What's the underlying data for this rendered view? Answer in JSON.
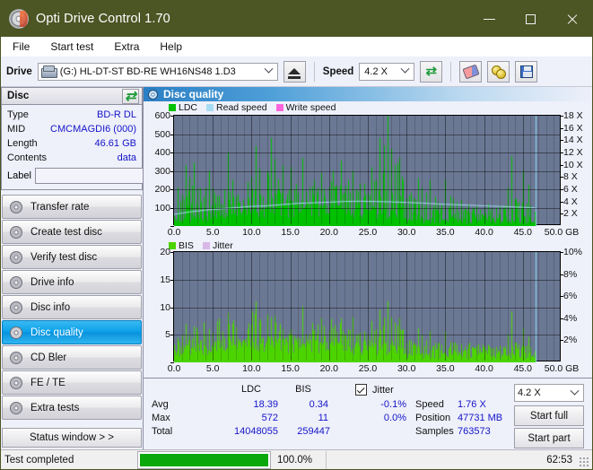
{
  "window": {
    "title": "Opti Drive Control 1.70",
    "icon": "disc-icon",
    "minimize": "minimize",
    "maximize": "maximize",
    "close": "close"
  },
  "menu": [
    "File",
    "Start test",
    "Extra",
    "Help"
  ],
  "toolbar": {
    "drive_label": "Drive",
    "drive_value": "(G:)  HL-DT-ST BD-RE  WH16NS48 1.D3",
    "eject_icon": "eject-icon",
    "speed_label": "Speed",
    "speed_value": "4.2 X",
    "refresh_icon": "refresh-icon",
    "erase_icon": "erase-icon",
    "gold_icon": "bookmark-icon",
    "save_icon": "save-icon"
  },
  "disc": {
    "title": "Disc",
    "refresh_icon": "refresh-icon",
    "rows": [
      {
        "key": "Type",
        "value": "BD-R DL"
      },
      {
        "key": "MID",
        "value": "CMCMAGDI6 (000)"
      },
      {
        "key": "Length",
        "value": "46.61 GB"
      },
      {
        "key": "Contents",
        "value": "data"
      }
    ],
    "label_key": "Label",
    "label_value": "",
    "label_placeholder": "",
    "label_button_icon": "cd-icon"
  },
  "nav": {
    "items": [
      {
        "label": "Transfer rate",
        "active": false
      },
      {
        "label": "Create test disc",
        "active": false
      },
      {
        "label": "Verify test disc",
        "active": false
      },
      {
        "label": "Drive info",
        "active": false
      },
      {
        "label": "Disc info",
        "active": false
      },
      {
        "label": "Disc quality",
        "active": true
      },
      {
        "label": "CD Bler",
        "active": false
      },
      {
        "label": "FE / TE",
        "active": false
      },
      {
        "label": "Extra tests",
        "active": false
      }
    ],
    "status_window": "Status window > >"
  },
  "panel": {
    "title": "Disc quality",
    "icon": "disc-quality-icon"
  },
  "stats": {
    "col_ldc": "LDC",
    "col_bis": "BIS",
    "jitter_label": "Jitter",
    "jitter_checked": true,
    "rows": [
      {
        "label": "Avg",
        "ldc": "18.39",
        "bis": "0.34",
        "jitter": "-0.1%"
      },
      {
        "label": "Max",
        "ldc": "572",
        "bis": "11",
        "jitter": "0.0%"
      },
      {
        "label": "Total",
        "ldc": "14048055",
        "bis": "259447",
        "jitter": ""
      }
    ],
    "speed_label": "Speed",
    "speed_value": "1.76 X",
    "position_label": "Position",
    "position_value": "47731 MB",
    "samples_label": "Samples",
    "samples_value": "763573",
    "speed_select": "4.2 X",
    "start_full": "Start full",
    "start_part": "Start part"
  },
  "statusbar": {
    "text": "Test completed",
    "percent": "100.0%",
    "progress": 100,
    "time": "62:53"
  },
  "colors": {
    "titlebar": "#4c5524",
    "ldc_green": "#00c000",
    "bis_green": "#4cd400",
    "read_speed": "#a8dcf4",
    "write_speed": "#ff66dd",
    "jitter": "#d9b8e8",
    "plot_bg": "#6b7894",
    "value_blue": "#1414c8",
    "accent": "#0aa0e8",
    "progress": "#0aa80a"
  },
  "chart_data": [
    {
      "id": "top",
      "type": "area",
      "title": "",
      "xlabel": "GB",
      "ylabel": "",
      "xlim": [
        0,
        50
      ],
      "ylim": [
        0,
        600
      ],
      "y2lim": [
        0,
        18
      ],
      "y2label": "X",
      "xticks": [
        "0.0",
        "5.0",
        "10.0",
        "15.0",
        "20.0",
        "25.0",
        "30.0",
        "35.0",
        "40.0",
        "45.0",
        "50.0"
      ],
      "xtick_suffix": "GB",
      "yticks": [
        0,
        100,
        200,
        300,
        400,
        500,
        600
      ],
      "y2ticks": [
        2,
        4,
        6,
        8,
        10,
        12,
        14,
        16,
        18
      ],
      "grid": true,
      "legend": [
        {
          "name": "LDC",
          "color": "#00c000"
        },
        {
          "name": "Read speed",
          "color": "#a8dcf4"
        },
        {
          "name": "Write speed",
          "color": "#ff66dd"
        }
      ],
      "data_end_gb": 46.61,
      "series": [
        {
          "name": "LDC",
          "color": "#00c000",
          "type": "spike-area",
          "x": [
            0.0,
            0.5,
            1.0,
            1.5,
            2.0,
            2.5,
            3.0,
            3.5,
            4.0,
            4.5,
            5.0,
            5.5,
            6.0,
            6.5,
            7.0,
            7.5,
            8.0,
            8.5,
            9.0,
            9.5,
            10.0,
            10.5,
            11.0,
            11.5,
            12.0,
            12.5,
            13.0,
            13.5,
            14.0,
            14.5,
            15.0,
            15.5,
            16.0,
            16.5,
            17.0,
            17.5,
            18.0,
            18.5,
            19.0,
            19.5,
            20.0,
            20.5,
            21.0,
            21.5,
            22.0,
            22.5,
            23.0,
            23.5,
            24.0,
            24.5,
            25.0,
            25.5,
            26.0,
            26.5,
            27.0,
            27.5,
            28.0,
            28.5,
            29.0,
            29.5,
            30.0,
            30.5,
            31.0,
            31.5,
            32.0,
            32.5,
            33.0,
            33.5,
            34.0,
            34.5,
            35.0,
            35.5,
            36.0,
            36.5,
            37.0,
            37.5,
            38.0,
            38.5,
            39.0,
            39.5,
            40.0,
            40.5,
            41.0,
            41.5,
            42.0,
            42.5,
            43.0,
            43.5,
            44.0,
            44.5,
            45.0,
            45.5,
            46.0,
            46.6
          ],
          "baseline": [
            28,
            34,
            40,
            44,
            46,
            50,
            52,
            54,
            56,
            58,
            60,
            62,
            64,
            66,
            66,
            68,
            70,
            72,
            72,
            74,
            76,
            78,
            80,
            82,
            84,
            86,
            86,
            88,
            90,
            90,
            92,
            92,
            94,
            94,
            96,
            96,
            96,
            96,
            96,
            96,
            94,
            94,
            94,
            92,
            92,
            90,
            90,
            88,
            88,
            86,
            84,
            82,
            80,
            78,
            76,
            74,
            72,
            70,
            68,
            64,
            40,
            36,
            34,
            32,
            32,
            30,
            30,
            30,
            28,
            28,
            28,
            28,
            28,
            28,
            28,
            26,
            26,
            26,
            26,
            26,
            26,
            26,
            26,
            26,
            26,
            26,
            26,
            26,
            26,
            26,
            26,
            26,
            26,
            26
          ],
          "peaks": [
            60,
            210,
            170,
            330,
            265,
            345,
            205,
            130,
            210,
            300,
            205,
            165,
            120,
            100,
            400,
            250,
            160,
            130,
            115,
            240,
            130,
            435,
            180,
            160,
            300,
            480,
            365,
            200,
            330,
            145,
            320,
            200,
            180,
            370,
            190,
            210,
            250,
            150,
            290,
            160,
            210,
            300,
            210,
            355,
            180,
            250,
            300,
            200,
            230,
            230,
            180,
            320,
            250,
            480,
            290,
            600,
            420,
            330,
            370,
            250,
            150,
            180,
            120,
            260,
            210,
            130,
            250,
            110,
            130,
            120,
            250,
            100,
            150,
            130,
            140,
            100,
            120,
            100,
            110,
            90,
            100,
            120,
            90,
            100,
            110,
            100,
            160,
            380,
            150,
            130,
            300,
            120,
            110,
            80
          ]
        },
        {
          "name": "Read speed",
          "color": "#a8dcf4",
          "type": "line",
          "axis": "right",
          "x": [
            0.0,
            2.0,
            4.0,
            6.0,
            8.0,
            10.0,
            12.0,
            14.0,
            16.0,
            18.0,
            20.0,
            22.0,
            24.0,
            26.0,
            28.0,
            30.0,
            32.0,
            34.0,
            36.0,
            38.0,
            40.0,
            42.0,
            44.0,
            46.0,
            46.6
          ],
          "values": [
            1.9,
            2.3,
            2.6,
            2.8,
            3.0,
            3.2,
            3.3,
            3.5,
            3.7,
            3.8,
            3.9,
            4.0,
            4.05,
            4.0,
            3.95,
            3.85,
            3.75,
            3.6,
            3.5,
            3.4,
            3.3,
            3.2,
            3.1,
            3.0,
            2.95
          ]
        }
      ]
    },
    {
      "id": "bottom",
      "type": "area",
      "title": "",
      "xlabel": "GB",
      "ylabel": "",
      "xlim": [
        0,
        50
      ],
      "ylim": [
        0,
        20
      ],
      "y2lim": [
        0,
        10
      ],
      "y2label": "%",
      "xticks": [
        "0.0",
        "5.0",
        "10.0",
        "15.0",
        "20.0",
        "25.0",
        "30.0",
        "35.0",
        "40.0",
        "45.0",
        "50.0"
      ],
      "xtick_suffix": "GB",
      "yticks": [
        0,
        5,
        10,
        15,
        20
      ],
      "y2ticks": [
        2,
        4,
        6,
        8,
        10
      ],
      "grid": true,
      "legend": [
        {
          "name": "BIS",
          "color": "#4cd400"
        },
        {
          "name": "Jitter",
          "color": "#d9b8e8"
        }
      ],
      "data_end_gb": 46.61,
      "series": [
        {
          "name": "BIS",
          "color": "#4cd400",
          "type": "spike-area",
          "x": [
            0.0,
            0.5,
            1.0,
            1.5,
            2.0,
            2.5,
            3.0,
            3.5,
            4.0,
            4.5,
            5.0,
            5.5,
            6.0,
            6.5,
            7.0,
            7.5,
            8.0,
            8.5,
            9.0,
            9.5,
            10.0,
            10.5,
            11.0,
            11.5,
            12.0,
            12.5,
            13.0,
            13.5,
            14.0,
            14.5,
            15.0,
            15.5,
            16.0,
            16.5,
            17.0,
            17.5,
            18.0,
            18.5,
            19.0,
            19.5,
            20.0,
            20.5,
            21.0,
            21.5,
            22.0,
            22.5,
            23.0,
            23.5,
            24.0,
            24.5,
            25.0,
            25.5,
            26.0,
            26.5,
            27.0,
            27.5,
            28.0,
            28.5,
            29.0,
            29.5,
            30.0,
            30.5,
            31.0,
            31.5,
            32.0,
            32.5,
            33.0,
            33.5,
            34.0,
            34.5,
            35.0,
            35.5,
            36.0,
            36.5,
            37.0,
            37.5,
            38.0,
            38.5,
            39.0,
            39.5,
            40.0,
            40.5,
            41.0,
            41.5,
            42.0,
            42.5,
            43.0,
            43.5,
            44.0,
            44.5,
            45.0,
            45.5,
            46.0,
            46.6
          ],
          "baseline": [
            1.6,
            1.8,
            2.2,
            2.4,
            2.6,
            2.7,
            2.7,
            2.8,
            2.8,
            2.9,
            3.0,
            3.0,
            3.1,
            3.2,
            3.2,
            3.3,
            3.3,
            3.4,
            3.4,
            3.5,
            3.5,
            3.5,
            3.5,
            3.5,
            3.5,
            3.5,
            3.5,
            3.4,
            3.4,
            3.4,
            3.4,
            3.3,
            3.3,
            3.3,
            3.3,
            3.2,
            3.2,
            3.2,
            3.1,
            3.1,
            3.1,
            3.0,
            3.0,
            3.0,
            3.0,
            2.9,
            2.9,
            2.9,
            2.9,
            2.9,
            2.9,
            2.8,
            2.8,
            2.8,
            2.8,
            2.8,
            2.7,
            2.6,
            2.5,
            2.3,
            1.6,
            1.5,
            1.5,
            1.5,
            1.5,
            1.4,
            1.4,
            1.4,
            1.4,
            1.4,
            1.4,
            1.4,
            1.4,
            1.4,
            1.4,
            1.4,
            1.4,
            1.4,
            1.4,
            1.4,
            1.4,
            1.4,
            1.4,
            1.4,
            1.4,
            1.4,
            1.4,
            1.4,
            1.4,
            1.4,
            1.4,
            1.4,
            1.4,
            1.3
          ],
          "peaks": [
            3.2,
            4.5,
            5.0,
            7.0,
            5.2,
            6.5,
            4.5,
            4.0,
            5.0,
            6.0,
            5.4,
            4.4,
            4.0,
            3.8,
            9.0,
            6.2,
            4.6,
            4.2,
            4.0,
            6.0,
            5.2,
            11.0,
            5.0,
            4.6,
            8.7,
            8.2,
            8.5,
            5.6,
            6.0,
            4.6,
            6.0,
            4.8,
            4.6,
            10.2,
            5.0,
            5.2,
            6.0,
            4.6,
            8.0,
            4.8,
            5.6,
            6.2,
            5.5,
            8.0,
            5.2,
            6.0,
            8.2,
            5.0,
            5.4,
            5.6,
            5.0,
            7.5,
            6.0,
            9.5,
            6.6,
            11.1,
            8.2,
            7.2,
            8.0,
            6.0,
            3.6,
            4.0,
            3.2,
            6.2,
            5.0,
            3.2,
            5.6,
            3.0,
            3.4,
            3.2,
            5.6,
            2.8,
            3.6,
            3.2,
            3.4,
            2.8,
            3.2,
            2.8,
            3.0,
            2.6,
            2.8,
            3.2,
            2.6,
            2.8,
            3.0,
            2.8,
            4.0,
            9.2,
            3.6,
            3.2,
            6.2,
            3.0,
            2.8,
            2.4
          ]
        },
        {
          "name": "Jitter",
          "color": "#d9b8e8",
          "type": "line",
          "axis": "right",
          "x": [],
          "values": []
        }
      ]
    }
  ]
}
